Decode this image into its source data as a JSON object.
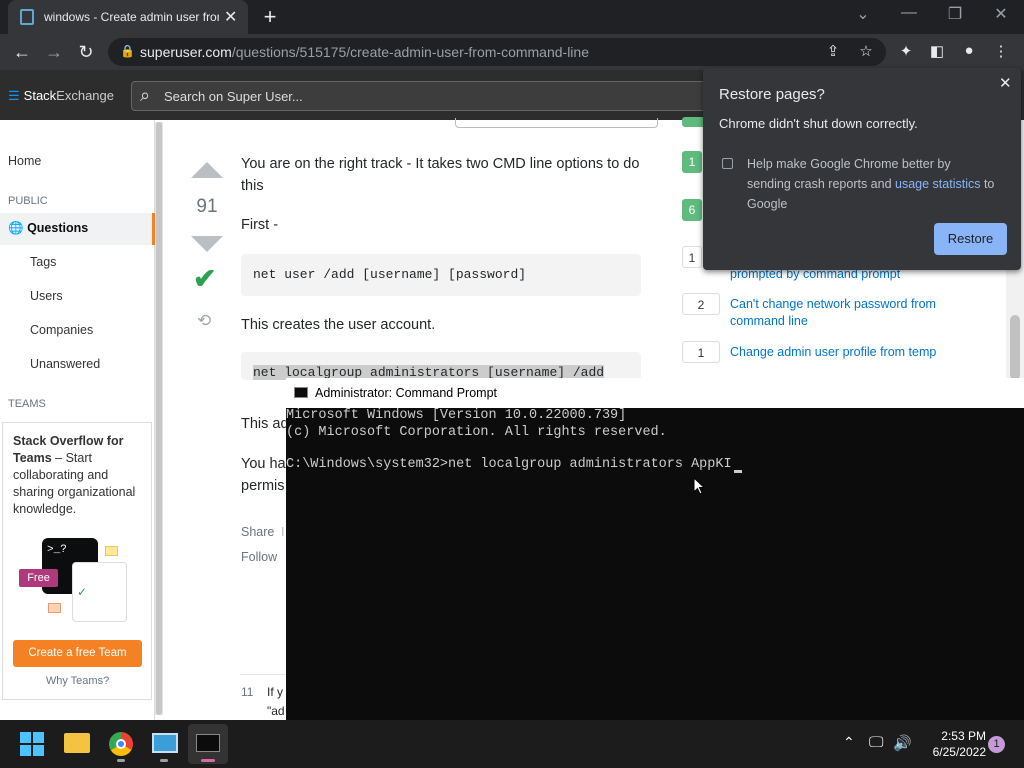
{
  "browser": {
    "tab_title": "windows - Create admin user from",
    "url_domain": "superuser.com",
    "url_path": "/questions/515175/create-admin-user-from-command-line"
  },
  "se_header": {
    "logo_text_a": "Stack",
    "logo_text_b": "Exchange",
    "search_placeholder": "Search on Super User..."
  },
  "left_nav": {
    "home": "Home",
    "public_label": "PUBLIC",
    "questions": "Questions",
    "tags": "Tags",
    "users": "Users",
    "companies": "Companies",
    "unanswered": "Unanswered",
    "teams_label": "TEAMS",
    "teams_promo_title": "Stack Overflow for Teams",
    "teams_promo_body": " – Start collaborating and sharing organizational knowledge.",
    "free_badge": "Free",
    "create_team": "Create a free Team",
    "why_teams": "Why Teams?"
  },
  "answer": {
    "vote_count": "91",
    "p1": "You are on the right track - It takes two CMD line options to do this",
    "p2": "First -",
    "code1": "net user /add [username] [password]",
    "p3": "This creates the user account.",
    "code2": "net localgroup administrators [username] /add",
    "p4_partial": "This ad",
    "p5_partial": "You ha",
    "p5b_partial": "permis",
    "share": "Share",
    "share_sep": "I",
    "follow": "Follow",
    "comment_votes": "11",
    "comment_partial": "If y",
    "comment_partial2": "\"ad"
  },
  "sidebar": {
    "related": [
      {
        "count": "",
        "title": "prompted by command prompt"
      },
      {
        "count": "2",
        "title": "Can't change network password from command line"
      },
      {
        "count": "1",
        "title": "Change admin user profile from temp"
      }
    ],
    "badge1": "1",
    "badge2": "6",
    "badge3": "1"
  },
  "restore_popup": {
    "title": "Restore pages?",
    "subtitle": "Chrome didn't shut down correctly.",
    "checkbox_text_a": "Help make Google Chrome better by sending crash reports and ",
    "checkbox_link": "usage statistics",
    "checkbox_text_b": " to Google",
    "restore_button": "Restore"
  },
  "cmd": {
    "title": "Administrator: Command Prompt",
    "line1": "Microsoft Windows [Version 10.0.22000.739]",
    "line2": "(c) Microsoft Corporation. All rights reserved.",
    "line3_prompt": "C:\\Windows\\system32>",
    "line3_input": "net localgroup administrators AppKI"
  },
  "taskbar": {
    "time": "2:53 PM",
    "date": "6/25/2022",
    "notification_count": "1"
  },
  "colors": {
    "chrome_dark": "#202124",
    "se_orange": "#f48225",
    "accept_green": "#2f9f52",
    "link_blue": "#0074cc",
    "restore_blue": "#8ab4f8"
  }
}
